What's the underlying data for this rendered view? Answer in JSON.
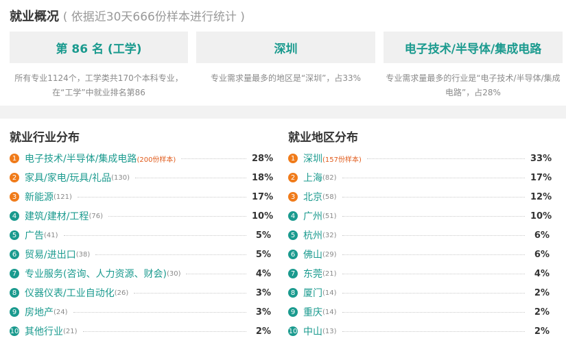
{
  "overview": {
    "title": "就业概况",
    "subtitle": "( 依据近30天666份样本进行统计 )",
    "cards": [
      {
        "value": "第 86 名 (工学)",
        "desc": "所有专业1124个，工学类共170个本科专业，在“工学”中就业排名第86"
      },
      {
        "value": "深圳",
        "desc": "专业需求量最多的地区是“深圳”，占33%"
      },
      {
        "value": "电子技术/半导体/集成电路",
        "desc": "专业需求量最多的行业是“电子技术/半导体/集成电路”，占28%"
      }
    ]
  },
  "industry": {
    "title": "就业行业分布",
    "items": [
      {
        "rank": "1",
        "name": "电子技术/半导体/集成电路",
        "count": "(200份样本)",
        "pct": "28%"
      },
      {
        "rank": "2",
        "name": "家具/家电/玩具/礼品",
        "count": "(130)",
        "pct": "18%"
      },
      {
        "rank": "3",
        "name": "新能源",
        "count": "(121)",
        "pct": "17%"
      },
      {
        "rank": "4",
        "name": "建筑/建材/工程",
        "count": "(76)",
        "pct": "10%"
      },
      {
        "rank": "5",
        "name": "广告",
        "count": "(41)",
        "pct": "5%"
      },
      {
        "rank": "6",
        "name": "贸易/进出口",
        "count": "(38)",
        "pct": "5%"
      },
      {
        "rank": "7",
        "name": "专业服务(咨询、人力资源、财会)",
        "count": "(30)",
        "pct": "4%"
      },
      {
        "rank": "8",
        "name": "仪器仪表/工业自动化",
        "count": "(26)",
        "pct": "3%"
      },
      {
        "rank": "9",
        "name": "房地产",
        "count": "(24)",
        "pct": "3%"
      },
      {
        "rank": "10",
        "name": "其他行业",
        "count": "(21)",
        "pct": "2%"
      }
    ]
  },
  "region": {
    "title": "就业地区分布",
    "items": [
      {
        "rank": "1",
        "name": "深圳",
        "count": "(157份样本)",
        "pct": "33%"
      },
      {
        "rank": "2",
        "name": "上海",
        "count": "(82)",
        "pct": "17%"
      },
      {
        "rank": "3",
        "name": "北京",
        "count": "(58)",
        "pct": "12%"
      },
      {
        "rank": "4",
        "name": "广州",
        "count": "(51)",
        "pct": "10%"
      },
      {
        "rank": "5",
        "name": "杭州",
        "count": "(32)",
        "pct": "6%"
      },
      {
        "rank": "6",
        "name": "佛山",
        "count": "(29)",
        "pct": "6%"
      },
      {
        "rank": "7",
        "name": "东莞",
        "count": "(21)",
        "pct": "4%"
      },
      {
        "rank": "8",
        "name": "厦门",
        "count": "(14)",
        "pct": "2%"
      },
      {
        "rank": "9",
        "name": "重庆",
        "count": "(14)",
        "pct": "2%"
      },
      {
        "rank": "10",
        "name": "中山",
        "count": "(13)",
        "pct": "2%"
      }
    ]
  },
  "colors": {
    "accent": "#1a9a8e",
    "top3": "#f07b1a"
  }
}
